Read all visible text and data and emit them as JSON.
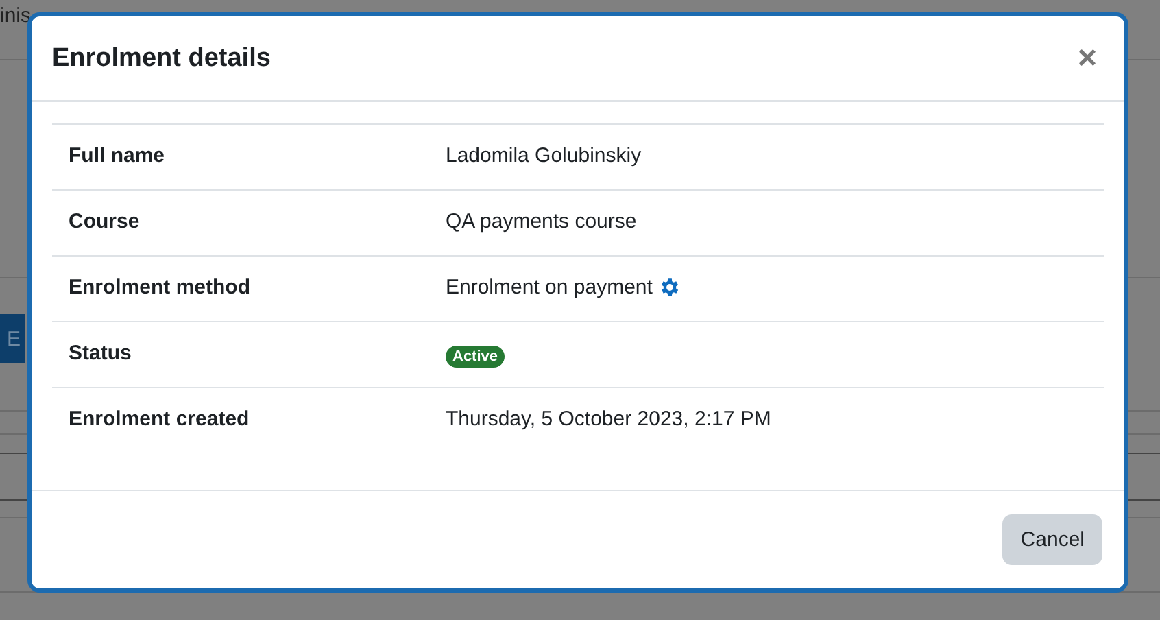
{
  "background_page": {
    "heading_fragment": "inis",
    "button_fragment": "E"
  },
  "dialog": {
    "title": "Enrolment details",
    "close_label": "×",
    "rows": [
      {
        "label": "Full name",
        "kind": "text",
        "value": "Ladomila Golubinskiy"
      },
      {
        "label": "Course",
        "kind": "text",
        "value": "QA payments course"
      },
      {
        "label": "Enrolment method",
        "kind": "text_with_icon",
        "value": "Enrolment on payment"
      },
      {
        "label": "Status",
        "kind": "badge",
        "value": "Active",
        "color": "#267a33"
      },
      {
        "label": "Enrolment created",
        "kind": "text",
        "value": "Thursday, 5 October 2023, 2:17 PM"
      }
    ],
    "buttons": [
      "Cancel"
    ]
  }
}
